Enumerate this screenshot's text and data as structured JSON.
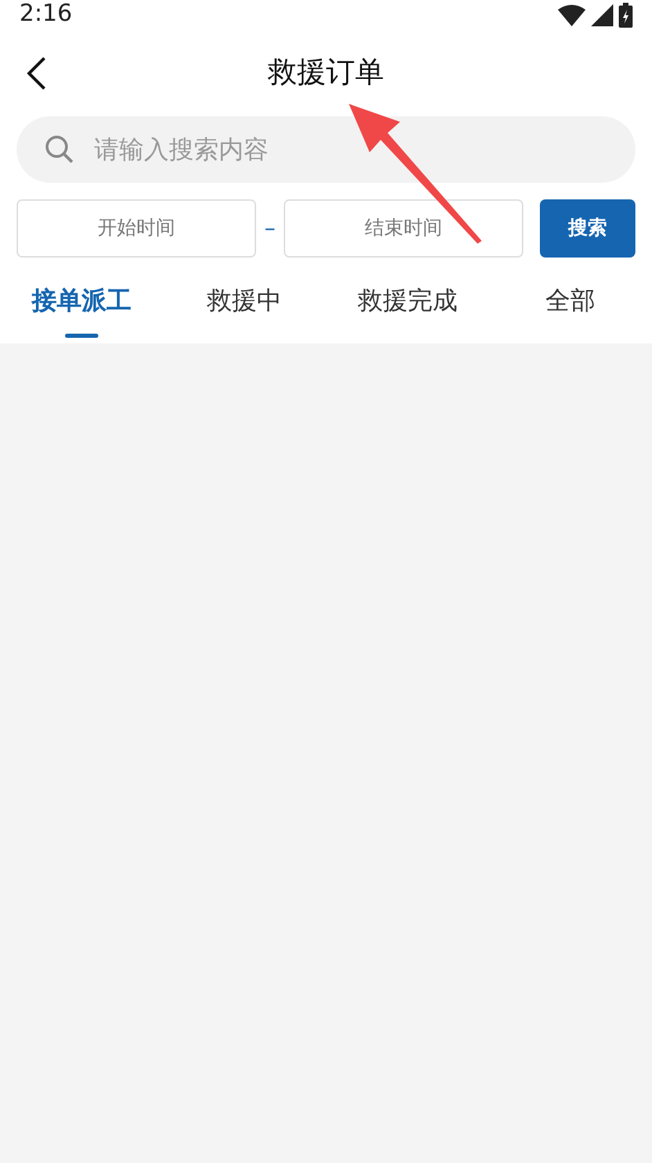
{
  "status_bar": {
    "time": "2:16"
  },
  "header": {
    "title": "救援订单"
  },
  "search": {
    "placeholder": "请输入搜索内容"
  },
  "date_filter": {
    "start_placeholder": "开始时间",
    "separator": "–",
    "end_placeholder": "结束时间",
    "button": "搜索"
  },
  "tabs": [
    {
      "label": "接单派工",
      "selected": true
    },
    {
      "label": "救援中",
      "selected": false
    },
    {
      "label": "救援完成",
      "selected": false
    },
    {
      "label": "全部",
      "selected": false
    }
  ]
}
